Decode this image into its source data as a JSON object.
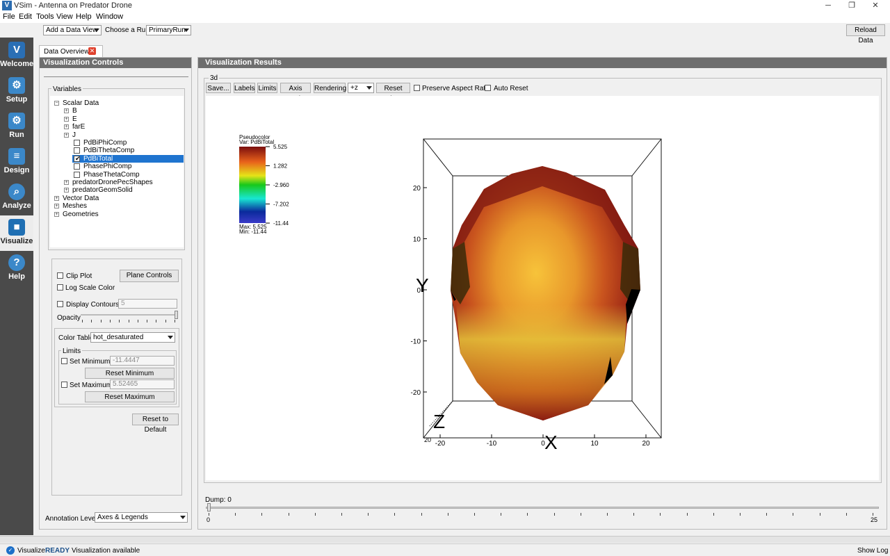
{
  "window": {
    "title": "VSim - Antenna on Predator Drone",
    "controls": [
      "─",
      "❐",
      "✕"
    ]
  },
  "menu": [
    "File",
    "Edit",
    "Tools",
    "View",
    "Help",
    "Window"
  ],
  "toolbar": {
    "add_view": "Add a Data View",
    "choose_run_label": "Choose a Run:",
    "run_value": "PrimaryRun",
    "reload": "Reload Data"
  },
  "tab": {
    "label": "Data Overview2"
  },
  "sidebar": [
    {
      "label": "Welcome",
      "icon": "vsim-logo-icon",
      "color": "#2a6fb5"
    },
    {
      "label": "Setup",
      "icon": "gear-icon",
      "color": "#3b88c9"
    },
    {
      "label": "Run",
      "icon": "gears-icon",
      "color": "#3b88c9"
    },
    {
      "label": "Design",
      "icon": "design-icon",
      "color": "#3b88c9"
    },
    {
      "label": "Analyze",
      "icon": "magnifier-icon",
      "color": "#3b88c9"
    },
    {
      "label": "Visualize",
      "icon": "cube-icon",
      "color": "#1f6fb3"
    },
    {
      "label": "Help",
      "icon": "question-icon",
      "color": "#3b88c9"
    }
  ],
  "controls": {
    "header": "Visualization Controls",
    "variables_label": "Variables",
    "tree": [
      {
        "label": "Scalar Data",
        "level": 0,
        "exp": "−"
      },
      {
        "label": "B",
        "level": 1,
        "exp": "+"
      },
      {
        "label": "E",
        "level": 1,
        "exp": "+"
      },
      {
        "label": "farE",
        "level": 1,
        "exp": "+"
      },
      {
        "label": "J",
        "level": 1,
        "exp": "+"
      },
      {
        "label": "PdBiPhiComp",
        "level": 2,
        "check": false
      },
      {
        "label": "PdBiThetaComp",
        "level": 2,
        "check": false
      },
      {
        "label": "PdBiTotal",
        "level": 2,
        "check": true,
        "selected": true
      },
      {
        "label": "PhasePhiComp",
        "level": 2,
        "check": false
      },
      {
        "label": "PhaseThetaComp",
        "level": 2,
        "check": false
      },
      {
        "label": "predatorDronePecShapes",
        "level": 1,
        "exp": "+"
      },
      {
        "label": "predatorGeomSolid",
        "level": 1,
        "exp": "+"
      },
      {
        "label": "Vector Data",
        "level": 0,
        "exp": "+"
      },
      {
        "label": "Meshes",
        "level": 0,
        "exp": "+"
      },
      {
        "label": "Geometries",
        "level": 0,
        "exp": "+"
      }
    ],
    "clip_plot": "Clip Plot",
    "plane_controls": "Plane Controls",
    "log_scale": "Log Scale Color",
    "display_contours": "Display Contours",
    "contours_value": "5",
    "opacity": "Opacity",
    "color_table_label": "Color Table",
    "color_table_value": "hot_desaturated",
    "limits": "Limits",
    "set_min": "Set Minimum",
    "min_value": "-11.4447",
    "reset_min": "Reset Minimum",
    "set_max": "Set Maximum",
    "max_value": "5.52465",
    "reset_max": "Reset Maximum",
    "reset_default": "Reset to Default",
    "annotation_label": "Annotation Level:",
    "annotation_value": "Axes & Legends"
  },
  "results": {
    "header": "Visualization Results",
    "group": "3d",
    "buttons": [
      "Save...",
      "Labels",
      "Limits",
      "Axis Scale",
      "Rendering"
    ],
    "view_combo": "+z",
    "reset_view": "Reset View",
    "preserve": "Preserve Aspect Ratio",
    "auto_reset": "Auto Reset",
    "legend": {
      "title": "Pseudocolor",
      "var": "Var: PdBiTotal",
      "ticks": [
        "5.525",
        "1.282",
        "-2.960",
        "-7.202",
        "-11.44"
      ],
      "max": "Max:  5.525",
      "min": "Min: -11.44"
    },
    "axes": {
      "y_ticks": [
        "20",
        "10",
        "0",
        "-10",
        "-20"
      ],
      "x_ticks": [
        "-20",
        "-10",
        "0",
        "10",
        "20"
      ],
      "z_tick": "20",
      "x_label": "X",
      "y_label": "Y",
      "z_label": "Z"
    }
  },
  "dump": {
    "label": "Dump: 0",
    "min": "0",
    "max": "25"
  },
  "status": {
    "label": "Visualize:",
    "state": "READY",
    "message": "Visualization available",
    "show_log": "Show Log"
  }
}
